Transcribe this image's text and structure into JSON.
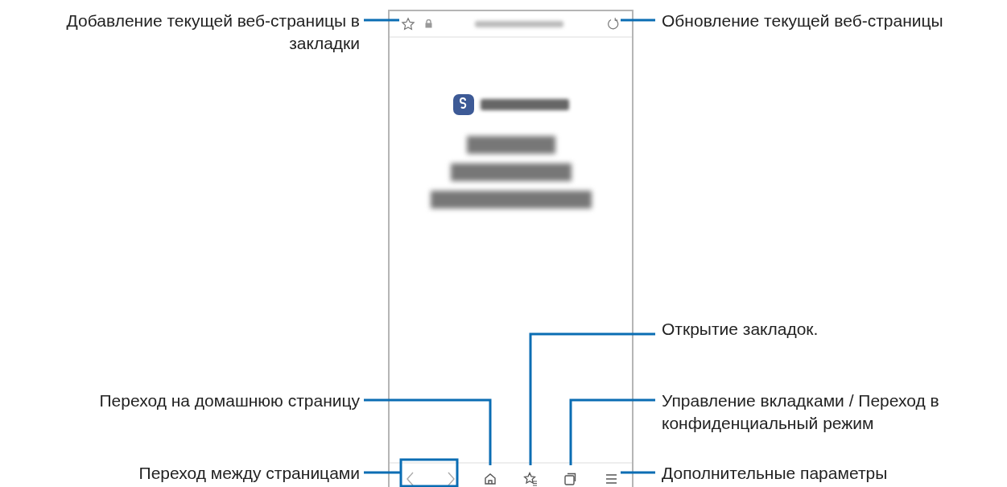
{
  "callouts": [
    {
      "text": "Добавление текущей веб-страницы в закладки",
      "kind": "left"
    },
    {
      "text": "Обновление текущей веб-страницы",
      "kind": "right"
    },
    {
      "text": "Открытие закладок.",
      "kind": "right"
    },
    {
      "text": "Переход на домашнюю страницу",
      "kind": "left"
    },
    {
      "text": "Управление вкладками / Переход в конфиденциальный режим",
      "kind": "right"
    },
    {
      "text": "Переход между страницами",
      "kind": "left"
    },
    {
      "text": "Дополнительные параметры",
      "kind": "right"
    }
  ]
}
